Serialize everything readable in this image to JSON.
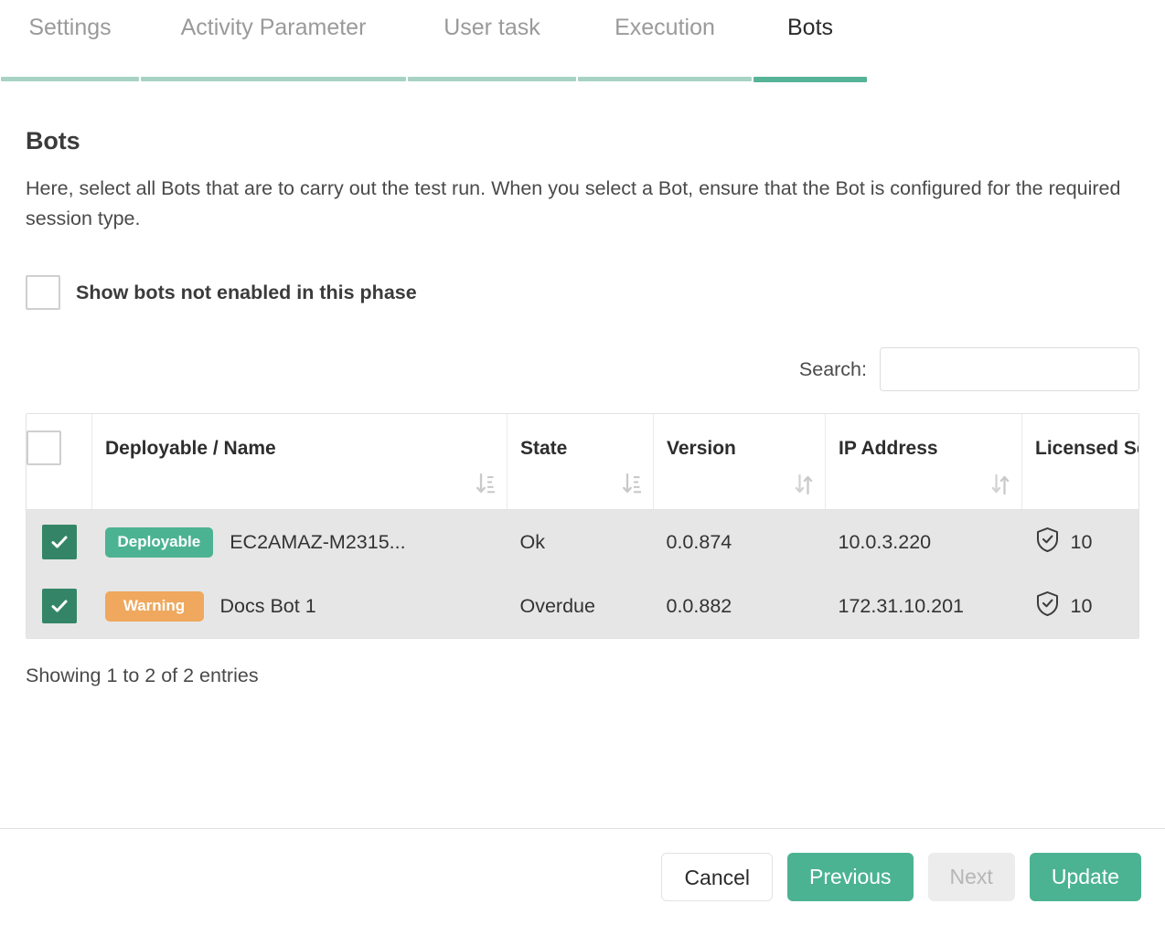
{
  "tabs": [
    {
      "label": "Settings",
      "active": false
    },
    {
      "label": "Activity Parameter",
      "active": false
    },
    {
      "label": "User task",
      "active": false
    },
    {
      "label": "Execution",
      "active": false
    },
    {
      "label": "Bots",
      "active": true
    }
  ],
  "page": {
    "title": "Bots",
    "description": "Here, select all Bots that are to carry out the test run. When you select a Bot, ensure that the Bot is configured for the required session type."
  },
  "options": {
    "show_disabled_label": "Show bots not enabled in this phase",
    "show_disabled_checked": false
  },
  "search": {
    "label": "Search:",
    "value": "",
    "placeholder": ""
  },
  "table": {
    "select_all_checked": false,
    "columns": [
      {
        "label": "Deployable / Name",
        "sort_icon": "sort-amount-down-icon"
      },
      {
        "label": "State",
        "sort_icon": "sort-amount-down-icon"
      },
      {
        "label": "Version",
        "sort_icon": "sort-icon"
      },
      {
        "label": "IP Address",
        "sort_icon": "sort-icon"
      },
      {
        "label": "Licensed Sessions",
        "sort_icon": "sort-icon"
      }
    ],
    "rows": [
      {
        "selected": true,
        "badge": "Deployable",
        "badge_color": "#4cb392",
        "name": "EC2AMAZ-M2315...",
        "state": "Ok",
        "version": "0.0.874",
        "ip": "10.0.3.220",
        "licensed_sessions": "10",
        "licensed_icon": "shield-check-icon"
      },
      {
        "selected": true,
        "badge": "Warning",
        "badge_color": "#efa85d",
        "name": "Docs Bot 1",
        "state": "Overdue",
        "version": "0.0.882",
        "ip": "172.31.10.201",
        "licensed_sessions": "10",
        "licensed_icon": "shield-check-icon"
      }
    ],
    "info": "Showing 1 to 2 of 2 entries"
  },
  "footer": {
    "cancel": "Cancel",
    "previous": "Previous",
    "next": "Next",
    "update": "Update"
  },
  "colors": {
    "accent_green": "#4cb392",
    "dark_green": "#348567",
    "warning_orange": "#efa85d",
    "tab_rule_inactive": "#a8d3c4",
    "tab_rule_active": "#56b396",
    "row_bg": "#e6e6e6"
  }
}
